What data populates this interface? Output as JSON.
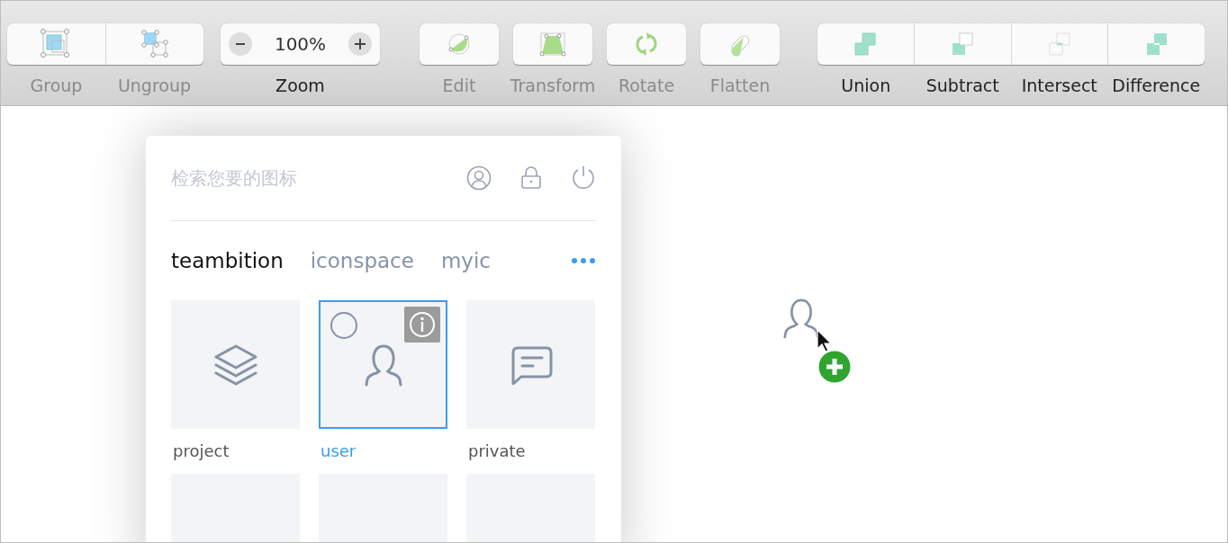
{
  "toolbar": {
    "items": [
      {
        "kind": "group",
        "label": "Group",
        "enabled": false
      },
      {
        "kind": "ungroup",
        "label": "Ungroup",
        "enabled": false
      },
      {
        "kind": "zoom",
        "label": "Zoom",
        "value": "100%",
        "enabled": true
      },
      {
        "kind": "edit",
        "label": "Edit",
        "enabled": false
      },
      {
        "kind": "transform",
        "label": "Transform",
        "enabled": false
      },
      {
        "kind": "rotate",
        "label": "Rotate",
        "enabled": false
      },
      {
        "kind": "flatten",
        "label": "Flatten",
        "enabled": false
      },
      {
        "kind": "union",
        "label": "Union",
        "enabled": true
      },
      {
        "kind": "subtract",
        "label": "Subtract",
        "enabled": true
      },
      {
        "kind": "intersect",
        "label": "Intersect",
        "enabled": true
      },
      {
        "kind": "difference",
        "label": "Difference",
        "enabled": true
      }
    ]
  },
  "panel": {
    "search": {
      "placeholder": "检索您要的图标"
    },
    "tabs": [
      {
        "label": "teambition",
        "selected": true
      },
      {
        "label": "iconspace",
        "selected": false
      },
      {
        "label": "myic",
        "selected": false
      }
    ],
    "tiles": [
      {
        "kind": "layers",
        "label": "project",
        "selected": false
      },
      {
        "kind": "user",
        "label": "user",
        "selected": true
      },
      {
        "kind": "message",
        "label": "private",
        "selected": false
      },
      {
        "kind": "partial",
        "selected": false
      },
      {
        "kind": "partial",
        "selected": false
      },
      {
        "kind": "partial",
        "selected": false
      }
    ]
  }
}
